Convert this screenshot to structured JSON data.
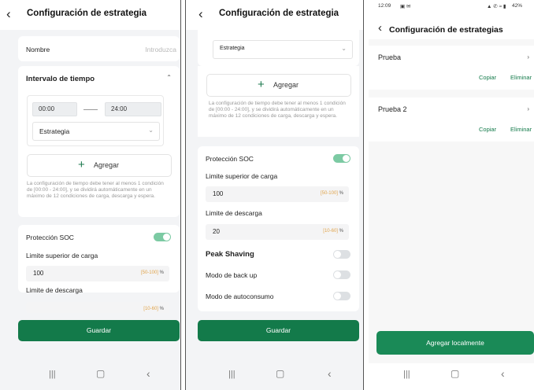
{
  "screens": [
    {
      "title": "Configuración de estrategia",
      "nombre_label": "Nombre",
      "nombre_placeholder": "Introduzca",
      "interval_title": "Intervalo de tiempo",
      "start_time": "00:00",
      "end_time": "24:00",
      "strategy_value": "Estrategia",
      "add_label": "Agregar",
      "note": "La configuración de tiempo debe tener al menos 1 condición de [00:00 - 24:00], y se dividirá automáticamente en un máximo de 12 condiciones de carga, descarga y espera.",
      "soc_label": "Protección SOC",
      "upper_label": "Limite superior de carga",
      "upper_value": "100",
      "upper_range": "[50-100]",
      "unit": "%",
      "discharge_label": "Limite de descarga",
      "discharge_range": "[10-60]",
      "save_label": "Guardar"
    },
    {
      "title": "Configuración de estrategia",
      "strategy_value": "Estrategia",
      "add_label": "Agregar",
      "note": "La configuración de tiempo debe tener al menos 1 condición de [00:00 - 24:00], y se dividirá automáticamente en un máximo de 12 condiciones de carga, descarga y espera.",
      "soc_label": "Protección SOC",
      "upper_label": "Limite superior de carga",
      "upper_value": "100",
      "upper_range": "[50-100]",
      "unit": "%",
      "discharge_label": "Limite de descarga",
      "discharge_value": "20",
      "discharge_range": "[10-60]",
      "peak_label": "Peak Shaving",
      "backup_label": "Modo de back up",
      "autoconsumo_label": "Modo de autoconsumo",
      "save_label": "Guardar"
    },
    {
      "status_time": "12:09",
      "status_right": "42%",
      "title": "Configuración de estrategias",
      "items": [
        {
          "name": "Prueba",
          "copy": "Copiar",
          "delete": "Eliminar"
        },
        {
          "name": "Prueba 2",
          "copy": "Copiar",
          "delete": "Eliminar"
        }
      ],
      "add_local_label": "Agregar localmente"
    }
  ],
  "toggles": {
    "soc": "on",
    "peak_shaving": "off",
    "back_up": "off",
    "autoconsumo": "off"
  },
  "colors": {
    "accent": "#137a4a",
    "toggle_on": "#7ccaa3",
    "range": "#e0a44c"
  },
  "nav_icons": [
    "recents-icon",
    "home-icon",
    "back-icon"
  ]
}
